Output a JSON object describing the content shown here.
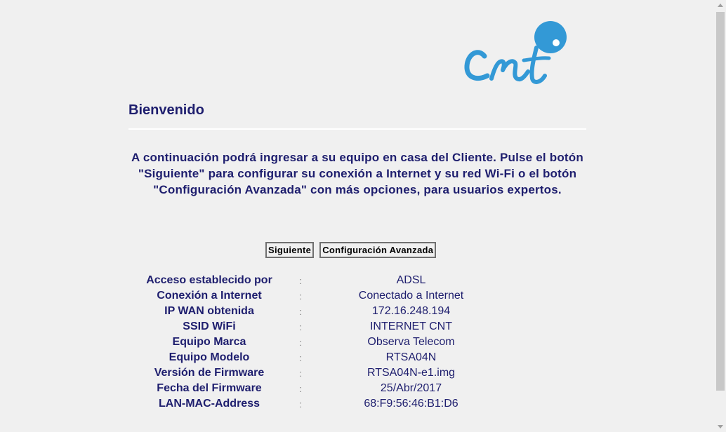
{
  "brand": {
    "logo_text": "Cnt",
    "color": "#3399d6"
  },
  "welcome": {
    "title": "Bienvenido",
    "intro": "A continuación podrá ingresar a su equipo en casa del Cliente. Pulse el botón \"Siguiente\" para configurar su conexión a Internet y su red Wi-Fi o el botón \"Configuración Avanzada\" con más opciones, para usuarios expertos."
  },
  "actions": {
    "next_label": "Siguiente",
    "advanced_label": "Configuración Avanzada"
  },
  "info": {
    "separator": ":",
    "rows": [
      {
        "label": "Acceso establecido por",
        "value": "ADSL"
      },
      {
        "label": "Conexión a Internet",
        "value": "Conectado a Internet"
      },
      {
        "label": "IP WAN obtenida",
        "value": "172.16.248.194"
      },
      {
        "label": "SSID WiFi",
        "value": "INTERNET CNT"
      },
      {
        "label": "Equipo Marca",
        "value": "Observa Telecom"
      },
      {
        "label": "Equipo Modelo",
        "value": "RTSA04N"
      },
      {
        "label": "Versión de Firmware",
        "value": "RTSA04N-e1.img"
      },
      {
        "label": "Fecha del Firmware",
        "value": "25/Abr/2017"
      },
      {
        "label": "LAN-MAC-Address",
        "value": "68:F9:56:46:B1:D6"
      }
    ]
  },
  "colors": {
    "text_primary": "#1e1e6e",
    "background": "#f0f0f0"
  }
}
